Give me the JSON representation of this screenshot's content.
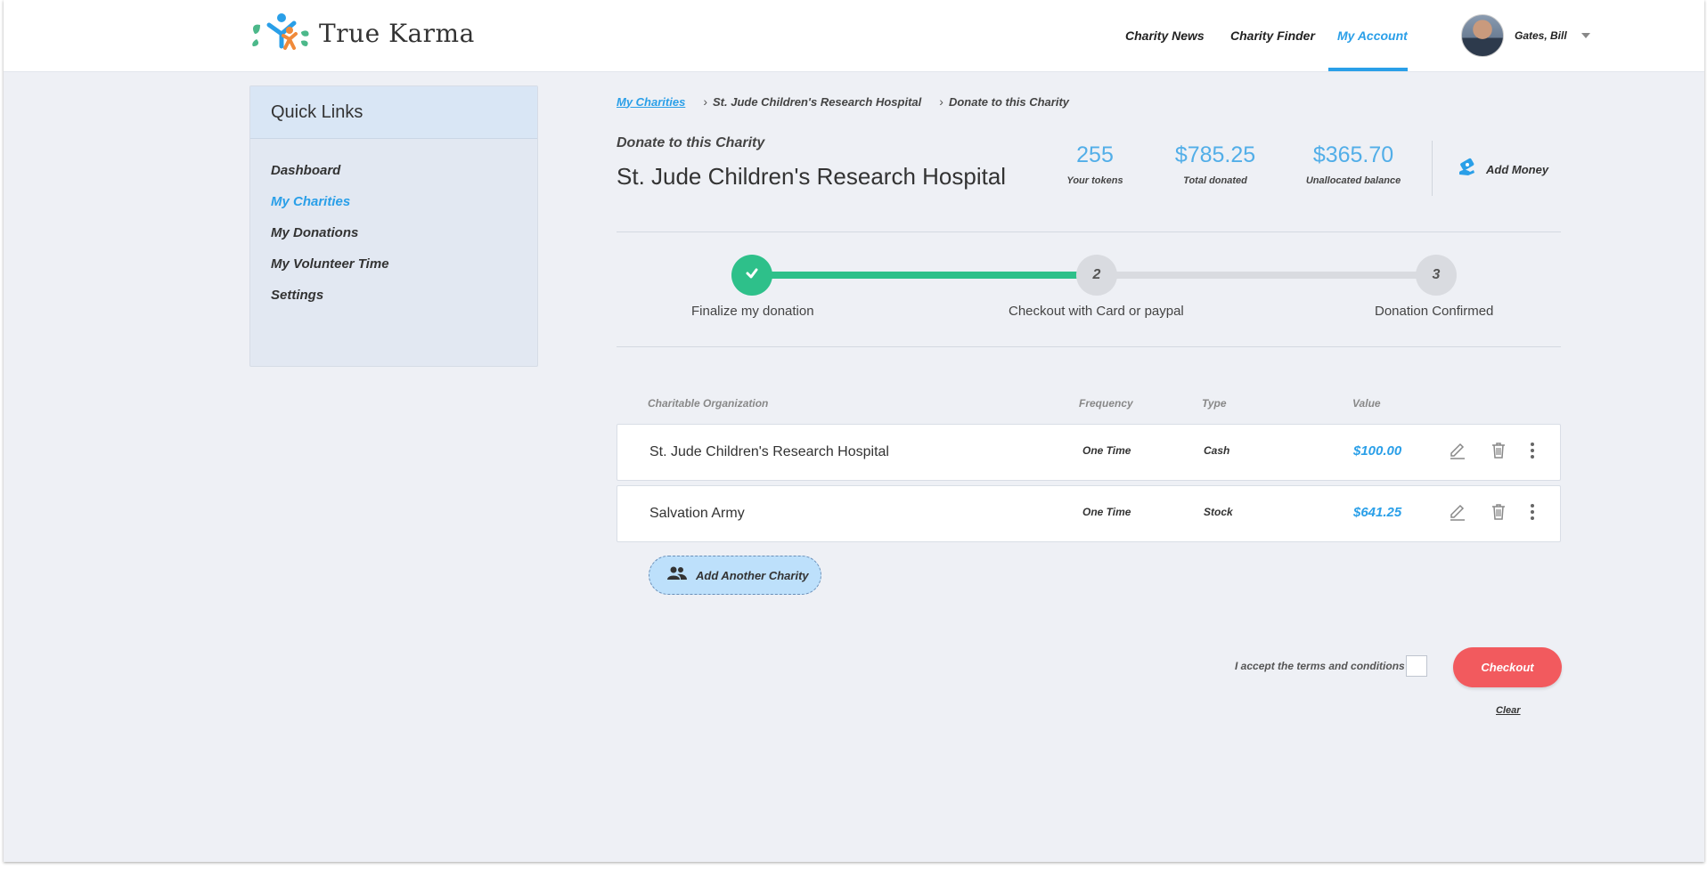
{
  "app": {
    "brand": "True Karma"
  },
  "nav": {
    "items": [
      {
        "label": "Charity News"
      },
      {
        "label": "Charity Finder"
      },
      {
        "label": "My Account"
      }
    ],
    "user_name": "Gates, Bill"
  },
  "sidebar": {
    "title": "Quick Links",
    "items": [
      {
        "label": "Dashboard"
      },
      {
        "label": "My Charities"
      },
      {
        "label": "My Donations"
      },
      {
        "label": "My Volunteer Time"
      },
      {
        "label": "Settings"
      }
    ]
  },
  "breadcrumb": {
    "items": [
      "My Charities",
      "St. Jude Children's Research Hospital",
      "Donate to this Charity"
    ]
  },
  "header_info": {
    "subtitle": "Donate to this Charity",
    "charity_name": "St. Jude Children's Research Hospital",
    "stats": [
      {
        "value": "255",
        "label": "Your tokens"
      },
      {
        "value": "$785.25",
        "label": "Total donated"
      },
      {
        "value": "$365.70",
        "label": "Unallocated balance"
      }
    ],
    "add_money_label": "Add Money"
  },
  "stepper": {
    "steps": [
      {
        "number": "",
        "label": "Finalize my donation",
        "status": "complete"
      },
      {
        "number": "2",
        "label": "Checkout with Card or paypal",
        "status": "current"
      },
      {
        "number": "3",
        "label": "Donation Confirmed",
        "status": "pending"
      }
    ],
    "colors": {
      "complete": "#2ec08a",
      "pending": "#d9dbe0"
    }
  },
  "table": {
    "columns": [
      "Charitable Organization",
      "Frequency",
      "Type",
      "Value"
    ],
    "rows": [
      {
        "org": "St. Jude Children's Research Hospital",
        "frequency": "One Time",
        "type": "Cash",
        "value": "$100.00"
      },
      {
        "org": "Salvation Army",
        "frequency": "One Time",
        "type": "Stock",
        "value": "$641.25"
      }
    ],
    "row_icons": [
      "pencil-icon",
      "trash-icon",
      "kebab-menu-icon"
    ]
  },
  "actions": {
    "add_charity_label": "Add Another Charity",
    "terms_label": "I accept the terms and conditions",
    "terms_checked": false,
    "checkout_label": "Checkout",
    "clear_label": "Clear"
  },
  "colors": {
    "accent": "#2a9fe8",
    "checkout": "#f25a5e",
    "success": "#2ec08a"
  }
}
